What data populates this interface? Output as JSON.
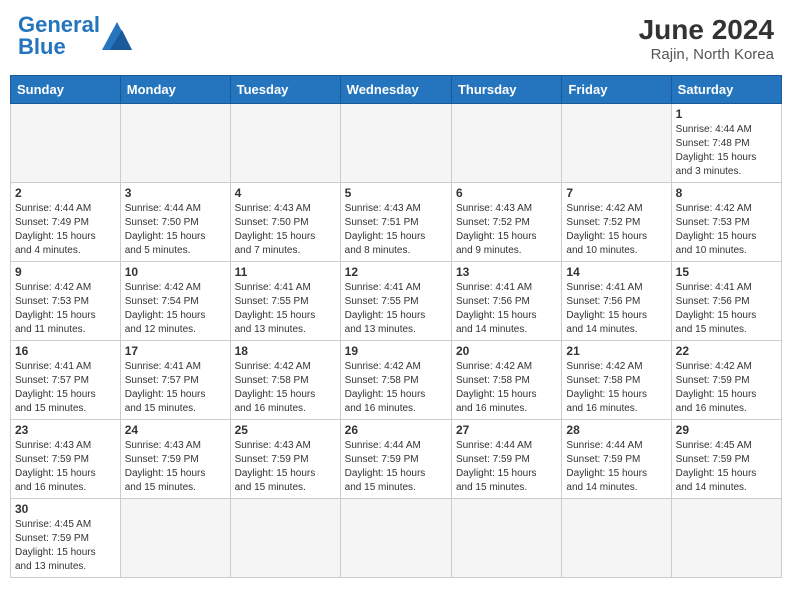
{
  "header": {
    "logo_general": "General",
    "logo_blue": "Blue",
    "month_year": "June 2024",
    "location": "Rajin, North Korea"
  },
  "days_of_week": [
    "Sunday",
    "Monday",
    "Tuesday",
    "Wednesday",
    "Thursday",
    "Friday",
    "Saturday"
  ],
  "weeks": [
    [
      {
        "day": "",
        "info": ""
      },
      {
        "day": "",
        "info": ""
      },
      {
        "day": "",
        "info": ""
      },
      {
        "day": "",
        "info": ""
      },
      {
        "day": "",
        "info": ""
      },
      {
        "day": "",
        "info": ""
      },
      {
        "day": "1",
        "info": "Sunrise: 4:44 AM\nSunset: 7:48 PM\nDaylight: 15 hours\nand 3 minutes."
      }
    ],
    [
      {
        "day": "2",
        "info": "Sunrise: 4:44 AM\nSunset: 7:49 PM\nDaylight: 15 hours\nand 4 minutes."
      },
      {
        "day": "3",
        "info": "Sunrise: 4:44 AM\nSunset: 7:50 PM\nDaylight: 15 hours\nand 5 minutes."
      },
      {
        "day": "4",
        "info": "Sunrise: 4:43 AM\nSunset: 7:50 PM\nDaylight: 15 hours\nand 7 minutes."
      },
      {
        "day": "5",
        "info": "Sunrise: 4:43 AM\nSunset: 7:51 PM\nDaylight: 15 hours\nand 8 minutes."
      },
      {
        "day": "6",
        "info": "Sunrise: 4:43 AM\nSunset: 7:52 PM\nDaylight: 15 hours\nand 9 minutes."
      },
      {
        "day": "7",
        "info": "Sunrise: 4:42 AM\nSunset: 7:52 PM\nDaylight: 15 hours\nand 10 minutes."
      },
      {
        "day": "8",
        "info": "Sunrise: 4:42 AM\nSunset: 7:53 PM\nDaylight: 15 hours\nand 10 minutes."
      }
    ],
    [
      {
        "day": "9",
        "info": "Sunrise: 4:42 AM\nSunset: 7:53 PM\nDaylight: 15 hours\nand 11 minutes."
      },
      {
        "day": "10",
        "info": "Sunrise: 4:42 AM\nSunset: 7:54 PM\nDaylight: 15 hours\nand 12 minutes."
      },
      {
        "day": "11",
        "info": "Sunrise: 4:41 AM\nSunset: 7:55 PM\nDaylight: 15 hours\nand 13 minutes."
      },
      {
        "day": "12",
        "info": "Sunrise: 4:41 AM\nSunset: 7:55 PM\nDaylight: 15 hours\nand 13 minutes."
      },
      {
        "day": "13",
        "info": "Sunrise: 4:41 AM\nSunset: 7:56 PM\nDaylight: 15 hours\nand 14 minutes."
      },
      {
        "day": "14",
        "info": "Sunrise: 4:41 AM\nSunset: 7:56 PM\nDaylight: 15 hours\nand 14 minutes."
      },
      {
        "day": "15",
        "info": "Sunrise: 4:41 AM\nSunset: 7:56 PM\nDaylight: 15 hours\nand 15 minutes."
      }
    ],
    [
      {
        "day": "16",
        "info": "Sunrise: 4:41 AM\nSunset: 7:57 PM\nDaylight: 15 hours\nand 15 minutes."
      },
      {
        "day": "17",
        "info": "Sunrise: 4:41 AM\nSunset: 7:57 PM\nDaylight: 15 hours\nand 15 minutes."
      },
      {
        "day": "18",
        "info": "Sunrise: 4:42 AM\nSunset: 7:58 PM\nDaylight: 15 hours\nand 16 minutes."
      },
      {
        "day": "19",
        "info": "Sunrise: 4:42 AM\nSunset: 7:58 PM\nDaylight: 15 hours\nand 16 minutes."
      },
      {
        "day": "20",
        "info": "Sunrise: 4:42 AM\nSunset: 7:58 PM\nDaylight: 15 hours\nand 16 minutes."
      },
      {
        "day": "21",
        "info": "Sunrise: 4:42 AM\nSunset: 7:58 PM\nDaylight: 15 hours\nand 16 minutes."
      },
      {
        "day": "22",
        "info": "Sunrise: 4:42 AM\nSunset: 7:59 PM\nDaylight: 15 hours\nand 16 minutes."
      }
    ],
    [
      {
        "day": "23",
        "info": "Sunrise: 4:43 AM\nSunset: 7:59 PM\nDaylight: 15 hours\nand 16 minutes."
      },
      {
        "day": "24",
        "info": "Sunrise: 4:43 AM\nSunset: 7:59 PM\nDaylight: 15 hours\nand 15 minutes."
      },
      {
        "day": "25",
        "info": "Sunrise: 4:43 AM\nSunset: 7:59 PM\nDaylight: 15 hours\nand 15 minutes."
      },
      {
        "day": "26",
        "info": "Sunrise: 4:44 AM\nSunset: 7:59 PM\nDaylight: 15 hours\nand 15 minutes."
      },
      {
        "day": "27",
        "info": "Sunrise: 4:44 AM\nSunset: 7:59 PM\nDaylight: 15 hours\nand 15 minutes."
      },
      {
        "day": "28",
        "info": "Sunrise: 4:44 AM\nSunset: 7:59 PM\nDaylight: 15 hours\nand 14 minutes."
      },
      {
        "day": "29",
        "info": "Sunrise: 4:45 AM\nSunset: 7:59 PM\nDaylight: 15 hours\nand 14 minutes."
      }
    ],
    [
      {
        "day": "30",
        "info": "Sunrise: 4:45 AM\nSunset: 7:59 PM\nDaylight: 15 hours\nand 13 minutes."
      },
      {
        "day": "",
        "info": ""
      },
      {
        "day": "",
        "info": ""
      },
      {
        "day": "",
        "info": ""
      },
      {
        "day": "",
        "info": ""
      },
      {
        "day": "",
        "info": ""
      },
      {
        "day": "",
        "info": ""
      }
    ]
  ]
}
